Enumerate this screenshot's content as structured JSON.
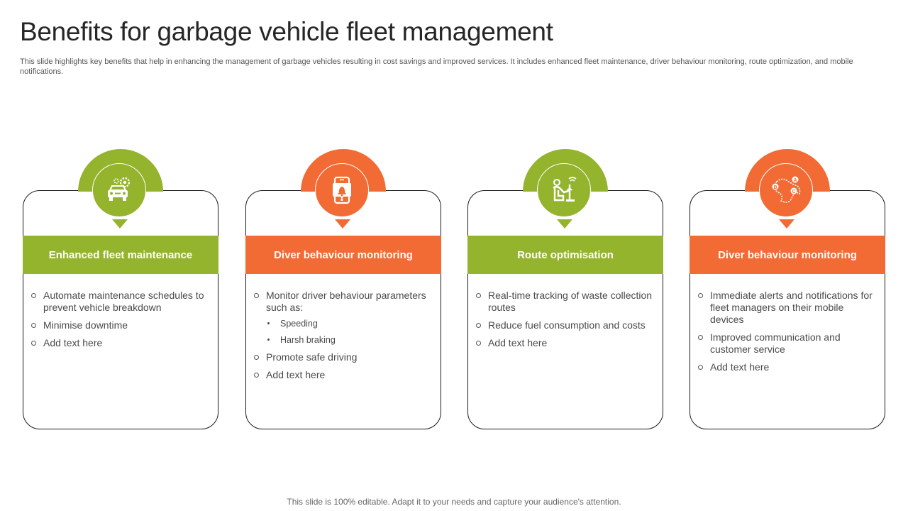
{
  "title": "Benefits for garbage vehicle fleet management",
  "subtitle": "This slide highlights key benefits that help in enhancing the management of garbage vehicles resulting in cost savings and improved services. It includes enhanced fleet maintenance, driver behaviour monitoring, route optimization, and mobile notifications.",
  "colors": {
    "green": "#94b42d",
    "orange": "#f26b35"
  },
  "cards": [
    {
      "heading": "Enhanced fleet maintenance",
      "icon": "car-gear-icon",
      "items": [
        "Automate maintenance schedules to prevent vehicle breakdown",
        "Minimise downtime",
        "Add text here"
      ]
    },
    {
      "heading": "Diver behaviour monitoring",
      "icon": "mobile-alert-icon",
      "items": [
        "Monitor driver behaviour parameters such as:",
        "Promote safe driving",
        "Add text here"
      ],
      "subitems": [
        "Speeding",
        "Harsh braking"
      ]
    },
    {
      "heading": "Route optimisation",
      "icon": "driver-steering-icon",
      "items": [
        "Real-time tracking of waste collection routes",
        "Reduce fuel consumption and costs",
        "Add text here"
      ]
    },
    {
      "heading": "Diver behaviour monitoring",
      "icon": "route-map-icon",
      "items": [
        "Immediate alerts and notifications for fleet managers on their mobile devices",
        "Improved communication and customer service",
        "Add text here"
      ],
      "route_labels": [
        "A",
        "B",
        "C"
      ]
    }
  ],
  "footer": "This slide is 100% editable. Adapt it to your needs and capture your audience's attention."
}
